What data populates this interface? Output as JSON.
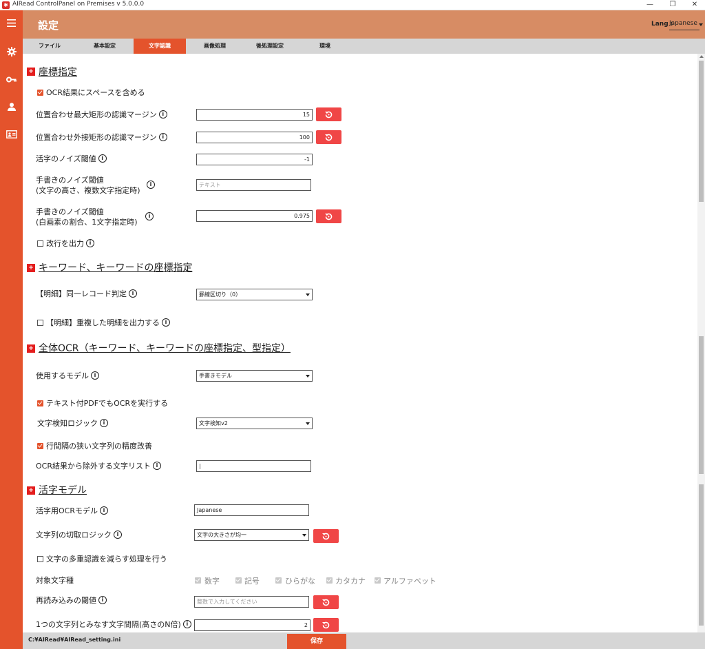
{
  "window": {
    "title": "AIRead ControlPanel on Premises v 5.0.0.0",
    "icon": "app-logo-icon",
    "controls": {
      "minimize": "—",
      "restore": "❐",
      "close": "✕"
    }
  },
  "sidebar": {
    "items": [
      {
        "icon": "hamburger-menu-icon"
      },
      {
        "icon": "gear-icon"
      },
      {
        "icon": "key-icon"
      },
      {
        "icon": "user-icon"
      },
      {
        "icon": "id-card-icon"
      }
    ]
  },
  "header": {
    "title": "設定",
    "lang_label": "Lang :",
    "lang_value": "Japanese"
  },
  "tabs": [
    {
      "label": "ファイル",
      "active": false
    },
    {
      "label": "基本設定",
      "active": false
    },
    {
      "label": "文字認識",
      "active": true
    },
    {
      "label": "画像処理",
      "active": false
    },
    {
      "label": "後処理設定",
      "active": false
    },
    {
      "label": "環境",
      "active": false
    }
  ],
  "section_coords": {
    "title": "座標指定",
    "ocr_space_label": "OCR結果にスペースを含める",
    "ocr_space_checked": true,
    "max_rect_label": "位置合わせ最大矩形の認識マージン",
    "max_rect_value": "15",
    "outer_rect_label": "位置合わせ外接矩形の認識マージン",
    "outer_rect_value": "100",
    "print_noise_label": "活字のノイズ閾値",
    "print_noise_value": "-1",
    "hand_noise_h_label1": "手書きのノイズ閾値",
    "hand_noise_h_label2": "(文字の高さ、複数文字指定時)",
    "hand_noise_h_placeholder": "テキスト",
    "hand_noise_w_label1": "手書きのノイズ閾値",
    "hand_noise_w_label2": "(白画素の割合、1文字指定時)",
    "hand_noise_w_value": "0.975",
    "newline_label": "改行を出力",
    "newline_checked": false
  },
  "section_keyword": {
    "title": "キーワード、キーワードの座標指定",
    "same_record_label": "【明細】同一レコード判定",
    "same_record_value": "罫線区切り（0）",
    "dup_detail_label": "【明細】重複した明細を出力する",
    "dup_detail_checked": false
  },
  "section_full_ocr": {
    "title": "全体OCR（キーワード、キーワードの座標指定、型指定）",
    "model_label": "使用するモデル",
    "model_value": "手書きモデル",
    "pdf_ocr_label": "テキスト付PDFでもOCRを実行する",
    "pdf_ocr_checked": true,
    "detect_logic_label": "文字検知ロジック",
    "detect_logic_value": "文字検知v2",
    "narrow_line_label": "行間隔の狭い文字列の精度改善",
    "narrow_line_checked": true,
    "exclude_list_label": "OCR結果から除外する文字リスト",
    "exclude_list_value": "|"
  },
  "section_print_model": {
    "title": "活字モデル",
    "ocr_model_label": "活字用OCRモデル",
    "ocr_model_value": "Japanese",
    "cut_logic_label": "文字列の切取ロジック",
    "cut_logic_value": "文字の大きさが均一",
    "multi_recog_label": "文字の多重認識を減らす処理を行う",
    "multi_recog_checked": false,
    "char_types_label": "対象文字種",
    "char_types": [
      "数字",
      "記号",
      "ひらがな",
      "カタカナ",
      "アルファベット"
    ],
    "reread_label": "再読み込みの閾値",
    "reread_placeholder": "整数で入力してください",
    "spacing_label": "1つの文字列とみなす文字間隔(高さのN倍)",
    "spacing_value": "2"
  },
  "footer": {
    "path": "C:¥AIRead¥AIRead_setting.ini",
    "save_label": "保存"
  },
  "colors": {
    "sidebar": "#e4532c",
    "header": "#d78c64",
    "accent": "#e4532c",
    "reset_button": "#f04646",
    "section_marker": "#e41e1e"
  }
}
